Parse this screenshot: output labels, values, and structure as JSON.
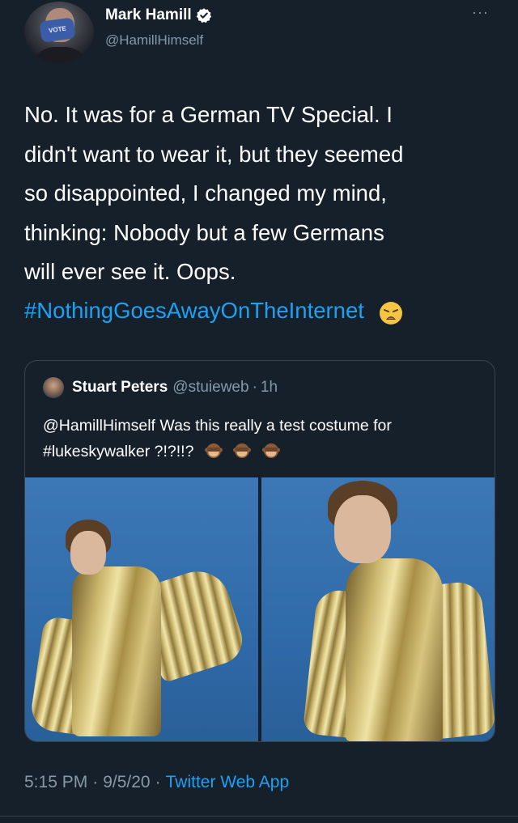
{
  "tweet": {
    "author": {
      "display_name": "Mark Hamill",
      "handle": "@HamillHimself",
      "verified": true,
      "avatar_mask_text": "VOTE"
    },
    "text": "No. It was for a German TV Special. I\ndidn't want to wear it, but they seemed\nso disappointed, I changed my mind,\nthinking: Nobody but a few Germans\nwill ever see it. Oops.",
    "hashtag": "#NothingGoesAwayOnTheInternet",
    "emoji": "weary-face",
    "time": "5:15 PM",
    "date": "9/5/20",
    "source": "Twitter Web App",
    "separator": "·"
  },
  "quote": {
    "display_name": "Stuart Peters",
    "handle": "@stuieweb",
    "separator": "·",
    "time_ago": "1h",
    "text": "@HamillHimself Was this really a test costume for #lukeskywalker ?!?!!?",
    "emojis": [
      "see-no-evil-monkey",
      "see-no-evil-monkey",
      "see-no-evil-monkey"
    ]
  },
  "colors": {
    "background": "#15202b",
    "link": "#1da1f2",
    "secondary_text": "#8899a6",
    "border": "#38444d",
    "photo_background": "#3d78b6"
  },
  "icons": {
    "verified": "verified-badge-icon",
    "more": "more-options-icon",
    "weary": "weary-face-icon",
    "monkey": "see-no-evil-monkey-icon"
  }
}
